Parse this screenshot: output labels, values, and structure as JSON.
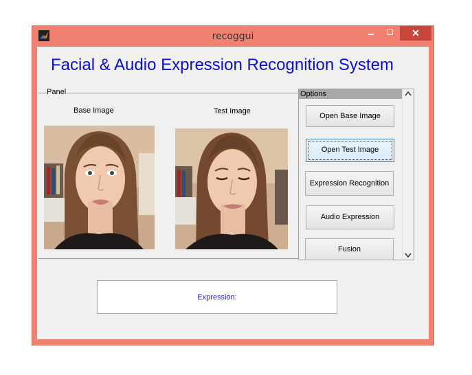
{
  "window": {
    "title": "recoggui",
    "icon": "matlab-icon",
    "close_glyph": "✕"
  },
  "heading": "Facial & Audio Expression Recognition System",
  "panel": {
    "label": "Panel",
    "base_image_label": "Base Image",
    "test_image_label": "Test Image"
  },
  "options": {
    "title": "Options",
    "buttons": [
      "Open Base Image",
      "Open Test Image",
      "Expression Recognition",
      "Audio Expression",
      "Fusion"
    ]
  },
  "expression": {
    "label": "Expression:"
  },
  "colors": {
    "heading": "#0a10d0",
    "frame": "#f08070",
    "close": "#c7463c",
    "expression_text": "#2020c0"
  }
}
